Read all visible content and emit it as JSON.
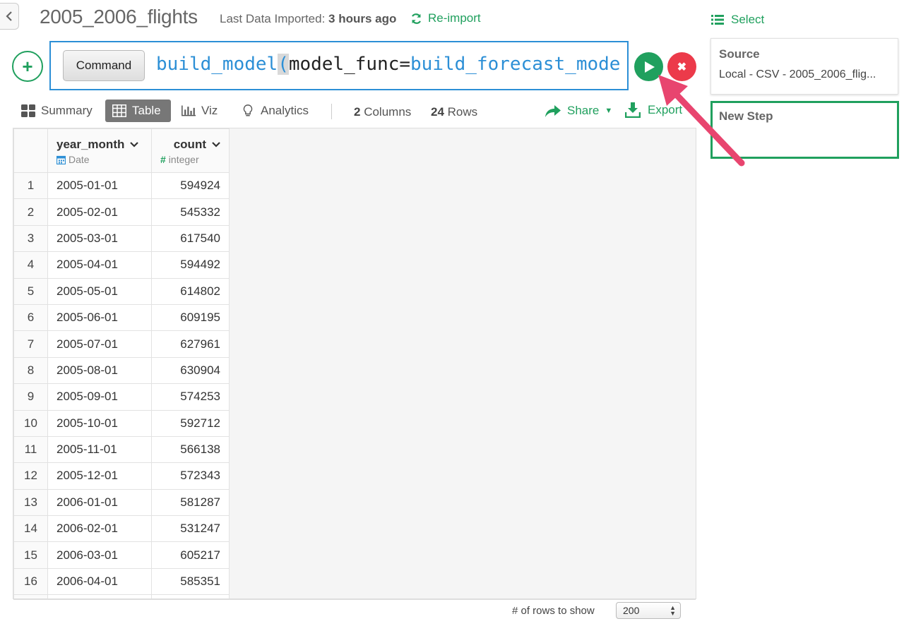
{
  "header": {
    "title": "2005_2006_flights",
    "last_imported_label": "Last Data Imported:",
    "last_imported_value": "3 hours ago",
    "reimport_label": "Re-import"
  },
  "command": {
    "label": "Command",
    "code_fn": "build_model",
    "code_paren": "(",
    "code_arg": "model_func=",
    "code_value": "build_forecast_mode"
  },
  "tabs": {
    "summary": "Summary",
    "table": "Table",
    "viz": "Viz",
    "analytics": "Analytics"
  },
  "stats": {
    "columns_count": "2",
    "columns_label": "Columns",
    "rows_count": "24",
    "rows_label": "Rows"
  },
  "actions": {
    "share": "Share",
    "export": "Export"
  },
  "right_panel": {
    "select_label": "Select",
    "source_title": "Source",
    "source_value": "Local - CSV - 2005_2006_flig...",
    "new_step_title": "New Step"
  },
  "table": {
    "columns": [
      {
        "name": "year_month",
        "type": "Date"
      },
      {
        "name": "count",
        "type": "integer"
      }
    ],
    "rows": [
      [
        "1",
        "2005-01-01",
        "594924"
      ],
      [
        "2",
        "2005-02-01",
        "545332"
      ],
      [
        "3",
        "2005-03-01",
        "617540"
      ],
      [
        "4",
        "2005-04-01",
        "594492"
      ],
      [
        "5",
        "2005-05-01",
        "614802"
      ],
      [
        "6",
        "2005-06-01",
        "609195"
      ],
      [
        "7",
        "2005-07-01",
        "627961"
      ],
      [
        "8",
        "2005-08-01",
        "630904"
      ],
      [
        "9",
        "2005-09-01",
        "574253"
      ],
      [
        "10",
        "2005-10-01",
        "592712"
      ],
      [
        "11",
        "2005-11-01",
        "566138"
      ],
      [
        "12",
        "2005-12-01",
        "572343"
      ],
      [
        "13",
        "2006-01-01",
        "581287"
      ],
      [
        "14",
        "2006-02-01",
        "531247"
      ],
      [
        "15",
        "2006-03-01",
        "605217"
      ],
      [
        "16",
        "2006-04-01",
        "585351"
      ]
    ]
  },
  "footer": {
    "rows_to_show_label": "# of rows to show",
    "rows_to_show_value": "200"
  },
  "colors": {
    "accent_green": "#20a05e",
    "command_blue": "#2c8fd6",
    "cancel_red": "#ec3a4a",
    "annotation_pink": "#e8456f"
  }
}
